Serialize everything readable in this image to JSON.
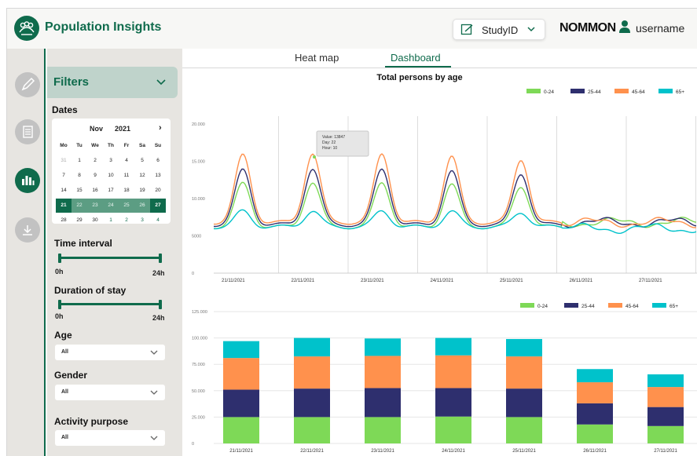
{
  "header": {
    "title": "Population Insights",
    "study_label": "StudyID",
    "brand": "NOMMON",
    "username": "username"
  },
  "tabs": [
    {
      "label": "Heat map",
      "active": false
    },
    {
      "label": "Dashboard",
      "active": true
    }
  ],
  "rail": [
    {
      "icon": "pencil-icon",
      "active": false
    },
    {
      "icon": "documents-icon",
      "active": false
    },
    {
      "icon": "bar-chart-icon",
      "active": true
    },
    {
      "icon": "download-icon",
      "active": false
    }
  ],
  "filters": {
    "title": "Filters",
    "dates": {
      "label": "Dates",
      "month": "Nov",
      "year": "2021",
      "day_names": [
        "Mo",
        "Tu",
        "We",
        "Th",
        "Fr",
        "Sa",
        "Su"
      ],
      "weeks": [
        [
          "31",
          "1",
          "2",
          "3",
          "4",
          "5",
          "6"
        ],
        [
          "7",
          "8",
          "9",
          "10",
          "11",
          "12",
          "13"
        ],
        [
          "14",
          "15",
          "16",
          "17",
          "18",
          "19",
          "20"
        ],
        [
          "21",
          "22",
          "23",
          "24",
          "25",
          "26",
          "27"
        ],
        [
          "28",
          "29",
          "30",
          "1",
          "2",
          "3",
          "4"
        ]
      ],
      "range_start": "21",
      "range_end": "27"
    },
    "time_interval": {
      "label": "Time interval",
      "min": "0h",
      "max": "24h",
      "low": 0,
      "high": 1
    },
    "duration": {
      "label": "Duration of stay",
      "min": "0h",
      "max": "24h",
      "low": 0,
      "high": 1
    },
    "age": {
      "label": "Age",
      "value": "All"
    },
    "gender": {
      "label": "Gender",
      "value": "All"
    },
    "activity": {
      "label": "Activity purpose",
      "value": "All"
    }
  },
  "colors": {
    "accent": "#0f6b4c",
    "series": [
      "#7ed957",
      "#2e2f6e",
      "#ff914d",
      "#00c2cb"
    ]
  },
  "chart_data": [
    {
      "type": "line",
      "title": "Total persons by age",
      "legend": [
        "0-24",
        "25-44",
        "45-64",
        "65+"
      ],
      "legend_position": "top-right",
      "x_ticks": [
        "21/11/2021",
        "22/11/2021",
        "23/11/2021",
        "24/11/2021",
        "25/11/2021",
        "26/11/2021",
        "27/11/2021"
      ],
      "y_ticks": [
        "0",
        "5000",
        "10.000",
        "15.000",
        "20.000"
      ],
      "ylim": [
        0,
        20000
      ],
      "grid": "vertical",
      "tooltip": {
        "value": "Value: 13847",
        "day": "Day: 22",
        "hour": "Hour: 10"
      },
      "series": [
        {
          "name": "0-24",
          "peak": 12000,
          "base": 6200,
          "late": 6800
        },
        {
          "name": "25-44",
          "peak": 13800,
          "base": 6500,
          "late": 6800
        },
        {
          "name": "45-64",
          "peak": 15800,
          "base": 6800,
          "late": 6800
        },
        {
          "name": "65+",
          "peak": 8300,
          "base": 6200,
          "late": 6000
        }
      ]
    },
    {
      "type": "bar",
      "stacked": true,
      "legend": [
        "0-24",
        "25-44",
        "45-64",
        "65+"
      ],
      "legend_position": "top-right",
      "categories": [
        "21/11/2021",
        "22/11/2021",
        "23/11/2021",
        "24/11/2021",
        "25/11/2021",
        "26/11/2021",
        "27/11/2021"
      ],
      "y_ticks": [
        "0",
        "25.000",
        "50.000",
        "75.000",
        "100.000",
        "125.000"
      ],
      "ylim": [
        0,
        125000
      ],
      "series": [
        {
          "name": "0-24",
          "values": [
            25000,
            25000,
            25000,
            25500,
            25000,
            18000,
            16500
          ]
        },
        {
          "name": "25-44",
          "values": [
            26000,
            27000,
            27500,
            27000,
            27000,
            20000,
            18000
          ]
        },
        {
          "name": "45-64",
          "values": [
            30000,
            30500,
            30500,
            31000,
            30500,
            20000,
            19000
          ]
        },
        {
          "name": "65+",
          "values": [
            16000,
            17500,
            16500,
            16500,
            16500,
            12500,
            12000
          ]
        }
      ]
    }
  ]
}
